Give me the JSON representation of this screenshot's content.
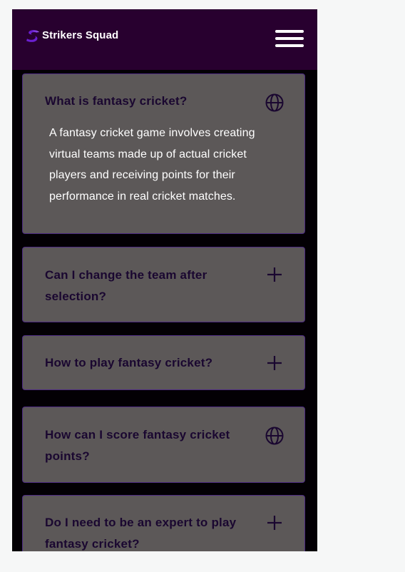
{
  "header": {
    "brand": "Strikers Squad",
    "logo_icon": "s-swoosh-logo-icon",
    "menu_icon": "hamburger-menu-icon"
  },
  "faq": {
    "items": [
      {
        "question": "What is fantasy cricket?",
        "answer": "A fantasy cricket game involves creating virtual teams made up of actual cricket players and receiving points for their performance in real cricket matches.",
        "icon": "globe-icon",
        "expanded": true
      },
      {
        "question": "Can I change the team after selection?",
        "icon": "plus-icon",
        "expanded": false
      },
      {
        "question": "How to play fantasy cricket?",
        "icon": "plus-icon",
        "expanded": false
      },
      {
        "question": "How can I score fantasy cricket points?",
        "icon": "globe-icon",
        "expanded": false
      },
      {
        "question": "Do I need to be an expert to play fantasy cricket?",
        "icon": "plus-icon",
        "expanded": false
      }
    ]
  },
  "colors": {
    "page_background": "#f6f7f7",
    "app_background": "#030004",
    "header_background": "#28002f",
    "card_background": "#5c5858",
    "card_border": "#4d2b82",
    "question_text": "#1a0730",
    "answer_text": "#ffffff",
    "brand_accent": "#6a1fd0"
  }
}
